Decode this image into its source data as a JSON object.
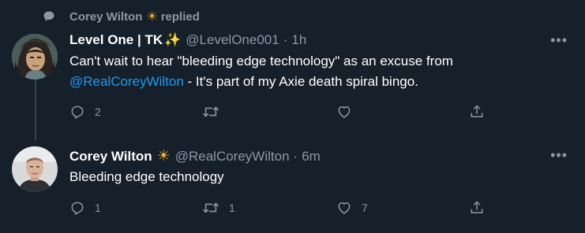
{
  "context": {
    "name": "Corey Wilton",
    "emoji": "☀",
    "action": "replied"
  },
  "tweets": [
    {
      "name": "Level One | TK",
      "emoji": "✨",
      "handle": "@LevelOne001",
      "dot": "·",
      "time": "1h",
      "more": "•••",
      "text_before": "Can't wait to hear \"bleeding edge technology\" as an excuse from",
      "mention": "@RealCoreyWilton",
      "text_after": " - It's part of my Axie death spiral bingo.",
      "reply_count": "2",
      "retweet_count": "",
      "like_count": "",
      "icons": [
        "reply-icon",
        "retweet-icon",
        "like-icon",
        "share-icon"
      ]
    },
    {
      "name": "Corey Wilton",
      "emoji": "☀",
      "handle": "@RealCoreyWilton",
      "dot": "·",
      "time": "6m",
      "more": "•••",
      "text": "Bleeding edge technology",
      "reply_count": "1",
      "retweet_count": "1",
      "like_count": "7",
      "icons": [
        "reply-icon",
        "retweet-icon",
        "like-icon",
        "share-icon"
      ]
    }
  ],
  "colors": {
    "background": "#15202b",
    "secondary_text": "#8b98a5",
    "link": "#1d9bf0",
    "thread_line": "#38444d"
  }
}
